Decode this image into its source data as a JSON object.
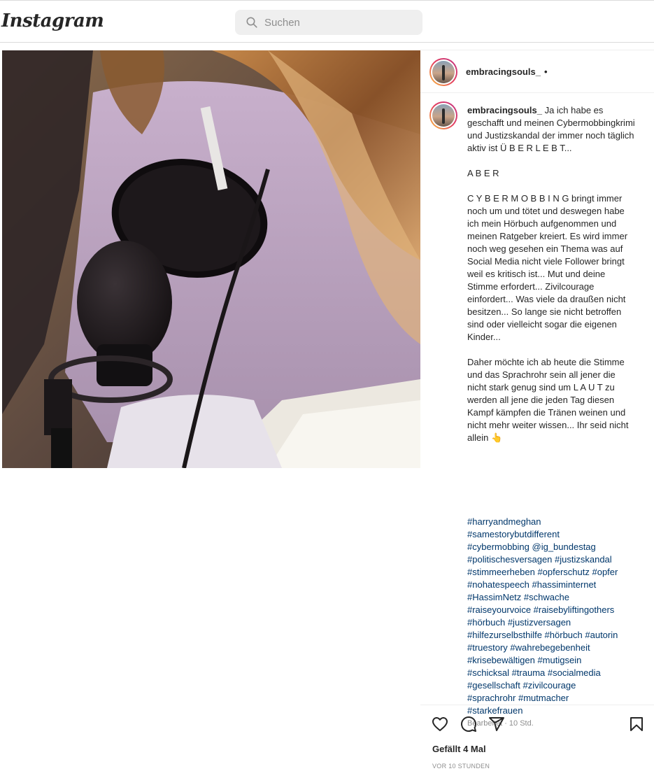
{
  "header": {
    "logo": "Instagram",
    "search_placeholder": "Suchen"
  },
  "post": {
    "username": "embracingsouls_",
    "follow_dot": "•",
    "caption": "Ja ich habe es geschafft und meinen Cybermobbingkrimi und Justizskandal der immer noch täglich aktiv ist Ü B E R L E B T...\n\nA B E R\n\nC Y B E R M O B B I N G bringt immer noch um und tötet und deswegen habe ich mein Hörbuch aufgenommen und meinen Ratgeber kreiert. Es wird immer noch weg gesehen ein Thema was auf Social Media nicht viele Follower bringt weil es kritisch ist... Mut und deine Stimme erfordert... Zivilcourage einfordert... Was viele da draußen nicht besitzen... So lange sie nicht betroffen sind oder vielleicht sogar die eigenen Kinder...\n\nDaher möchte ich ab heute die Stimme und das Sprachrohr sein all jener die nicht stark genug sind um L A U T zu werden all jene die jeden Tag diesen Kampf kämpfen die Tränen weinen und nicht mehr weiter wissen... Ihr seid nicht allein 👆",
    "hashtags": [
      "#harryandmeghan",
      "#samestorybutdifferent",
      "#cybermobbing @ig_bundestag",
      "#politischesversagen #justizskandal",
      "#stimmeerheben #opferschutz #opfer",
      "#nohatespeech #hassiminternet",
      "#HassimNetz #schwache",
      "#raiseyourvoice #raisebyliftingothers",
      "#hörbuch #justizversagen",
      "#hilfezurselbsthilfe #hörbuch #autorin",
      "#truestory #wahrebegebenheit",
      "#krisebewältigen #mutigsein",
      "#schicksal #trauma #socialmedia",
      "#gesellschaft #zivilcourage",
      "#sprachrohr #mutmacher",
      "#starkefrauen"
    ],
    "edited": "Bearbeitet · 10 Std.",
    "likes": "Gefällt 4 Mal",
    "time": "VOR 10 STUNDEN"
  },
  "icons": [
    "search-icon",
    "heart-icon",
    "comment-icon",
    "share-icon",
    "bookmark-icon"
  ]
}
